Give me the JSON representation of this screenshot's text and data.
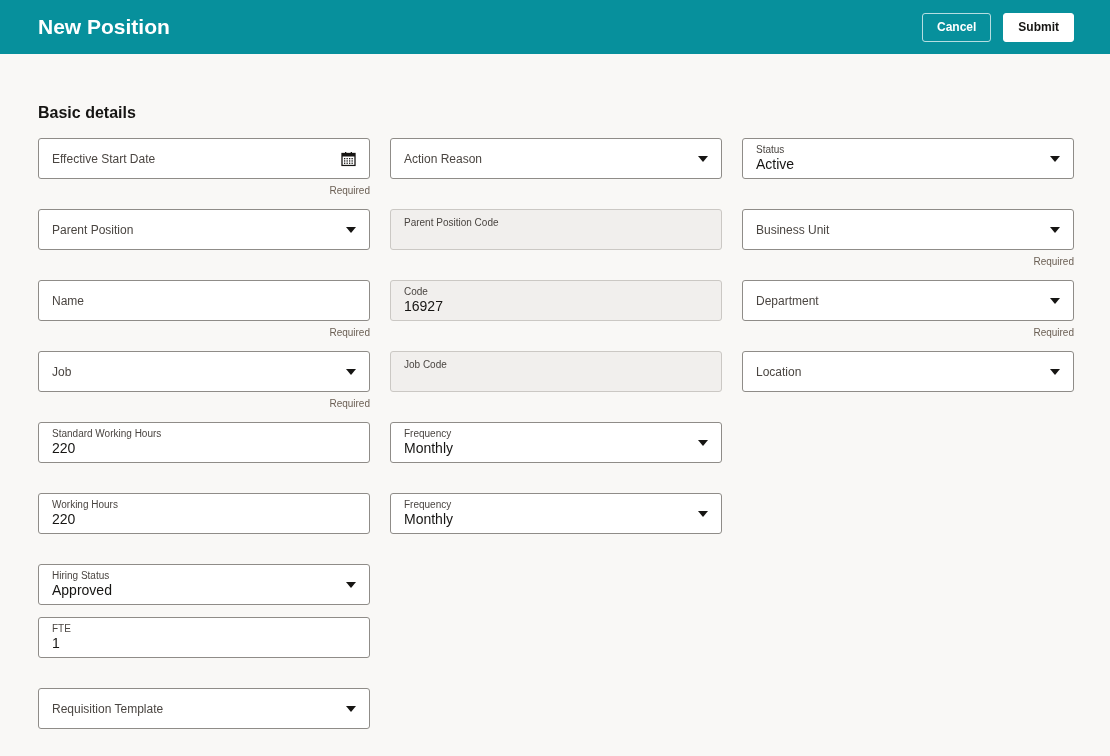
{
  "header": {
    "title": "New Position",
    "buttons": [
      {
        "label": "Cancel",
        "kind": "outline"
      },
      {
        "label": "Submit",
        "kind": "solid"
      }
    ]
  },
  "section": {
    "title": "Basic details"
  },
  "rows": [
    {
      "cells": [
        [
          {
            "label": "Effective Start Date",
            "kind": "date",
            "note": "Required"
          }
        ],
        [
          {
            "label": "Action Reason",
            "kind": "select"
          }
        ],
        [
          {
            "label": "Status",
            "kind": "select",
            "value": "Active"
          }
        ]
      ]
    },
    {
      "cells": [
        [
          {
            "label": "Parent Position",
            "kind": "select"
          }
        ],
        [
          {
            "label": "Parent Position Code",
            "kind": "readonly"
          }
        ],
        [
          {
            "label": "Business Unit",
            "kind": "select",
            "note": "Required"
          }
        ]
      ]
    },
    {
      "cells": [
        [
          {
            "label": "Name",
            "kind": "text",
            "note": "Required"
          }
        ],
        [
          {
            "label": "Code",
            "kind": "readonly",
            "value": "16927"
          }
        ],
        [
          {
            "label": "Department",
            "kind": "select",
            "note": "Required"
          }
        ]
      ]
    },
    {
      "cells": [
        [
          {
            "label": "Job",
            "kind": "select",
            "note": "Required"
          }
        ],
        [
          {
            "label": "Job Code",
            "kind": "readonly"
          }
        ],
        [
          {
            "label": "Location",
            "kind": "select"
          }
        ]
      ]
    },
    {
      "cells": [
        [
          {
            "label": "Standard Working Hours",
            "kind": "text",
            "value": "220"
          }
        ],
        [
          {
            "label": "Frequency",
            "kind": "select",
            "value": "Monthly"
          }
        ]
      ]
    },
    {
      "cells": [
        [
          {
            "label": "Working Hours",
            "kind": "text",
            "value": "220"
          }
        ],
        [
          {
            "label": "Frequency",
            "kind": "select",
            "value": "Monthly"
          }
        ]
      ]
    },
    {
      "cells": [
        [
          {
            "label": "Hiring Status",
            "kind": "select",
            "value": "Approved"
          },
          {
            "label": "FTE",
            "kind": "text",
            "value": "1"
          }
        ]
      ]
    },
    {
      "cells": [
        [
          {
            "label": "Requisition Template",
            "kind": "select"
          }
        ]
      ]
    }
  ]
}
